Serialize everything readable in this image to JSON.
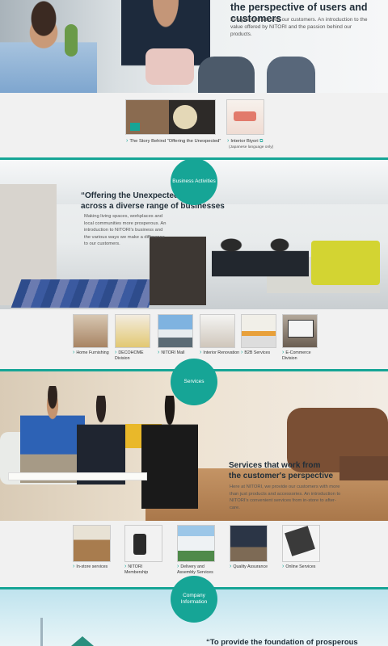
{
  "hero": {
    "title": "the perspective of users and customers",
    "text": "Everything starts with our customers. An introduction to the value offered by NITORI and the passion behind our products."
  },
  "links": [
    {
      "label": "The Story Behind “Offering the Unexpected”"
    },
    {
      "label": "Interior Biyori",
      "note": "(Japanese language only)"
    }
  ],
  "business": {
    "badge": "Business Activities",
    "title_line1": "“Offering the Unexpected”",
    "title_line2": "across a diverse range of businesses",
    "text": "Making living spaces, workplaces and local communities more prosperous. An introduction to NITORI's business and the various ways we make a difference to our customers.",
    "items": [
      {
        "label": "Home Furnishing"
      },
      {
        "label": "DECOHOME Division"
      },
      {
        "label": "NITORI Mall"
      },
      {
        "label": "Interior Renovation"
      },
      {
        "label": "B2B Services"
      },
      {
        "label": "E-Commerce Division"
      }
    ]
  },
  "services": {
    "badge": "Services",
    "title_line1": "Services that work from",
    "title_line2": "the customer's perspective",
    "text": "Here at NITORI, we provide our customers with more than just products and accessories. An introduction to NITORI's convenient services from in-store to after-care.",
    "items": [
      {
        "label": "In-store services"
      },
      {
        "label": "NITORI Membership"
      },
      {
        "label": "Delivery and Assembly Services"
      },
      {
        "label": "Quality Assurance"
      },
      {
        "label": "Online Services"
      }
    ]
  },
  "company": {
    "badge": "Company Information",
    "title": "“To provide the foundation of prosperous"
  },
  "colors": {
    "accent": "#16a596"
  }
}
